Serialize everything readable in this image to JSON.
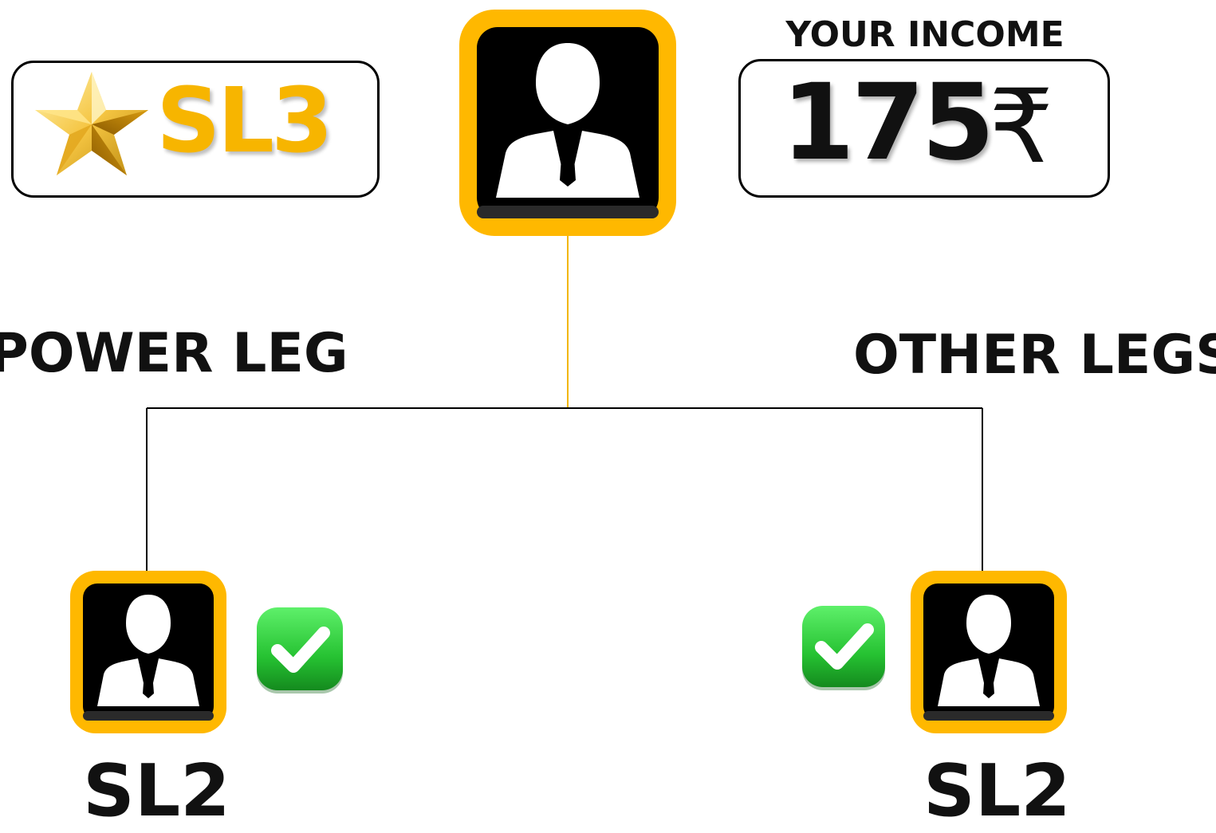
{
  "rank": {
    "label": "SL3",
    "icon": "gold-star-icon"
  },
  "income": {
    "title": "YOUR INCOME",
    "amount": "175",
    "currency_symbol": "₹"
  },
  "legs": {
    "left_title": "POWER LEG",
    "right_title": "OTHER LEGS"
  },
  "nodes": {
    "top": {
      "icon": "user-avatar-icon"
    },
    "left": {
      "label": "SL2",
      "status_icon": "check-icon"
    },
    "right": {
      "label": "SL2",
      "status_icon": "check-icon"
    }
  },
  "colors": {
    "accent": "#ffb800",
    "rank_text": "#f7b500",
    "check_green": "#2ecc40",
    "line_top": "#f2b600",
    "line": "#000000"
  }
}
